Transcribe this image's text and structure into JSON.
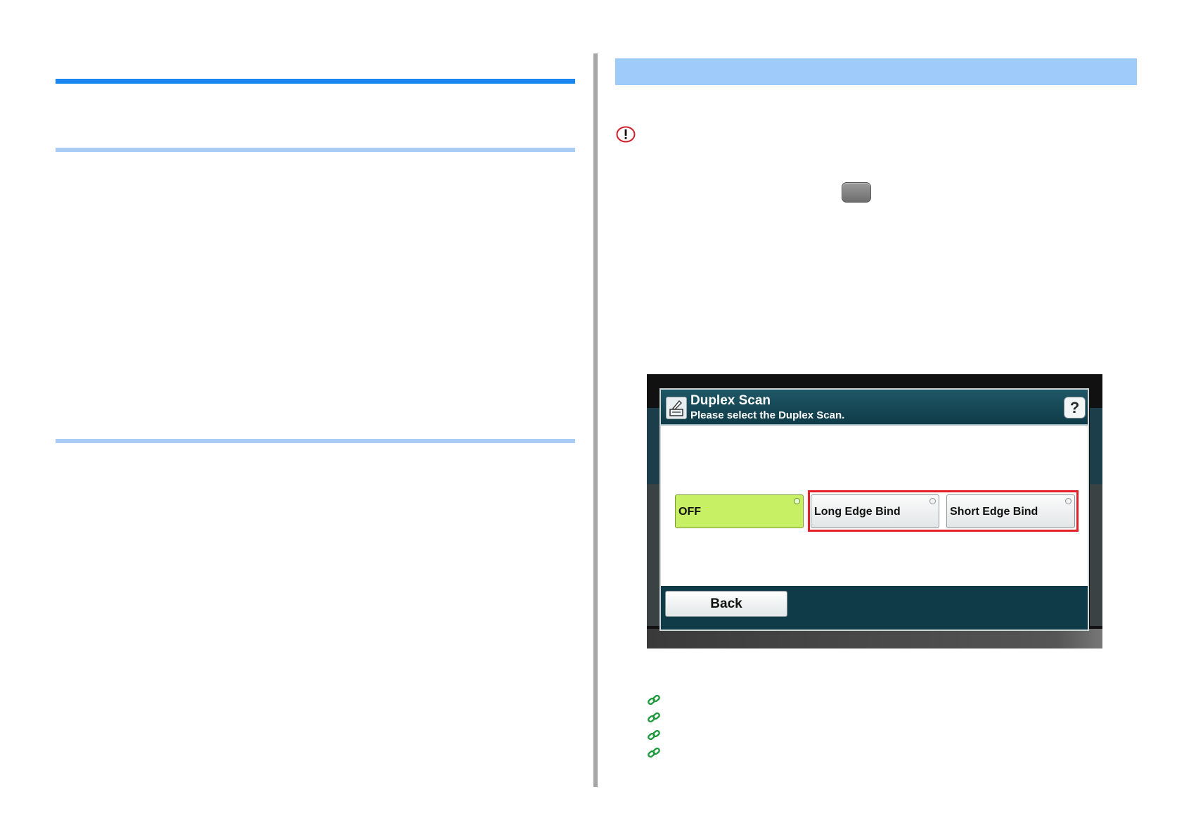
{
  "device_screen": {
    "title": "Duplex Scan",
    "subtitle": "Please select the Duplex Scan.",
    "help_glyph": "?",
    "options": [
      {
        "label": "OFF",
        "selected": true
      },
      {
        "label": "Long Edge Bind",
        "selected": false
      },
      {
        "label": "Short Edge Bind",
        "selected": false
      }
    ],
    "back_label": "Back"
  },
  "icons": {
    "caution": "caution-icon",
    "key": "gray-key-icon",
    "link": "link-icon",
    "help": "help-icon",
    "document": "document-icon"
  },
  "colors": {
    "heading_rule": "#1a86f0",
    "sub_rule": "#a9cdf7",
    "band": "#9ecbfa",
    "selected_option": "#c8f064",
    "highlight": "#e3202a",
    "link": "#1e9a3c"
  }
}
